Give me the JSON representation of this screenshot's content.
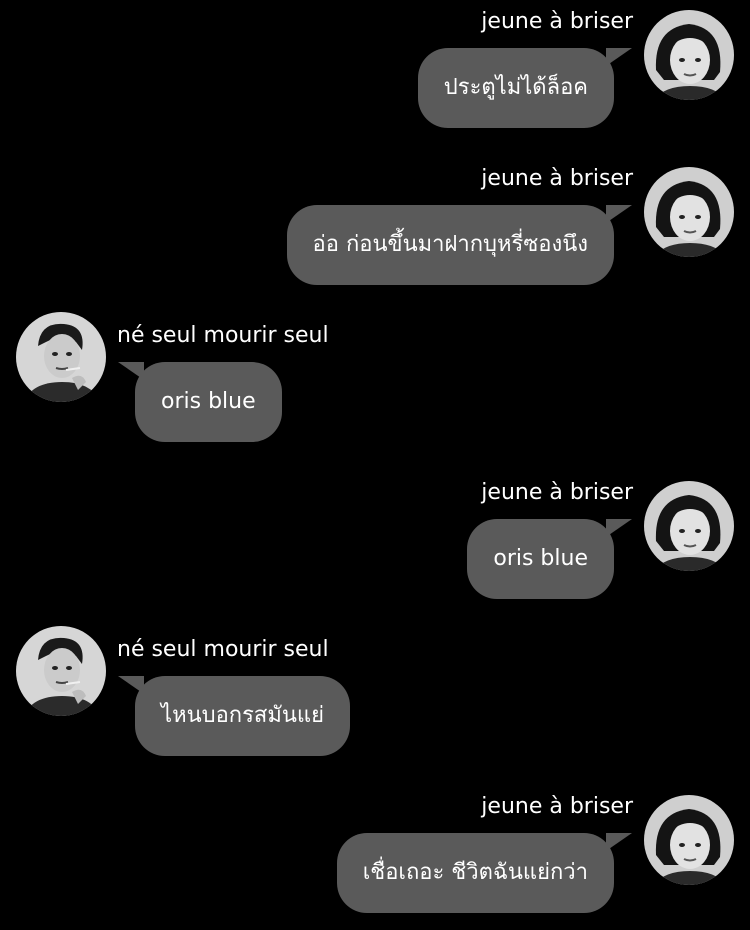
{
  "messages": [
    {
      "side": "right",
      "sender": "jeune à briser",
      "text": "ประตูไม่ได้ล็อค"
    },
    {
      "side": "right",
      "sender": "jeune à briser",
      "text": "อ่อ ก่อนขึ้นมาฝากบุหรี่ซองนึง"
    },
    {
      "side": "left",
      "sender": "né seul mourir seul",
      "text": "oris blue"
    },
    {
      "side": "right",
      "sender": "jeune à briser",
      "text": "oris blue"
    },
    {
      "side": "left",
      "sender": "né seul mourir seul",
      "text": "ไหนบอกรสมันแย่"
    },
    {
      "side": "right",
      "sender": "jeune à briser",
      "text": "เชื่อเถอะ ชีวิตฉันแย่กว่า"
    }
  ],
  "colors": {
    "background": "#000000",
    "bubble": "#5a5a5a",
    "text": "#ffffff"
  },
  "icons": {
    "right_avatar": "woman-bw-portrait-avatar",
    "left_avatar": "man-smoking-bw-portrait-avatar"
  }
}
